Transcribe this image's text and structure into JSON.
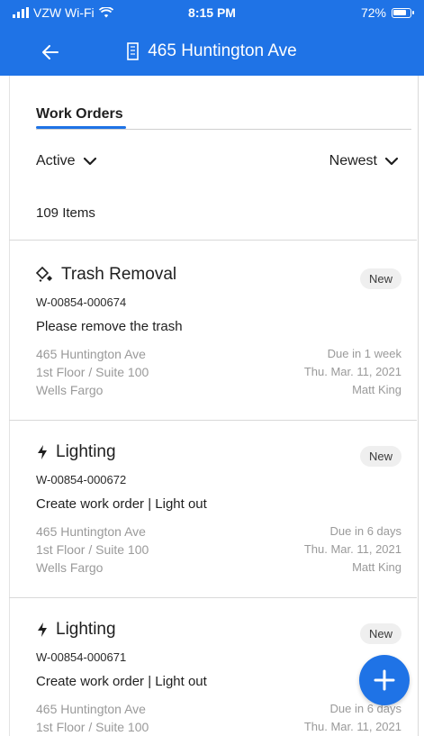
{
  "status_bar": {
    "carrier": "VZW Wi-Fi",
    "time": "8:15 PM",
    "battery": "72%"
  },
  "header": {
    "title": "465 Huntington Ave"
  },
  "tabs": [
    {
      "label": "Work Orders"
    }
  ],
  "filters": {
    "status": "Active",
    "sort": "Newest"
  },
  "list": {
    "count_label": "109 Items"
  },
  "work_orders": [
    {
      "icon": "sparkle-icon",
      "title": "Trash Removal",
      "badge": "New",
      "code": "W-00854-000674",
      "description": "Please remove the trash",
      "address": "465 Huntington Ave",
      "location": "1st Floor / Suite 100",
      "tenant": "Wells Fargo",
      "due": "Due in 1 week",
      "date": "Thu. Mar. 11, 2021",
      "assignee": "Matt King"
    },
    {
      "icon": "lightning-icon",
      "title": "Lighting",
      "badge": "New",
      "code": "W-00854-000672",
      "description": "Create work order | Light out",
      "address": "465 Huntington Ave",
      "location": "1st Floor / Suite 100",
      "tenant": "Wells Fargo",
      "due": "Due in 6 days",
      "date": "Thu. Mar. 11, 2021",
      "assignee": "Matt King"
    },
    {
      "icon": "lightning-icon",
      "title": "Lighting",
      "badge": "New",
      "code": "W-00854-000671",
      "description": "Create work order | Light out",
      "address": "465 Huntington Ave",
      "location": "1st Floor / Suite 100",
      "due": "Due in 6 days",
      "date": "Thu. Mar. 11, 2021"
    }
  ],
  "colors": {
    "primary": "#1f73e6",
    "muted_text": "#9a9a9a",
    "badge_bg": "#efefef"
  }
}
